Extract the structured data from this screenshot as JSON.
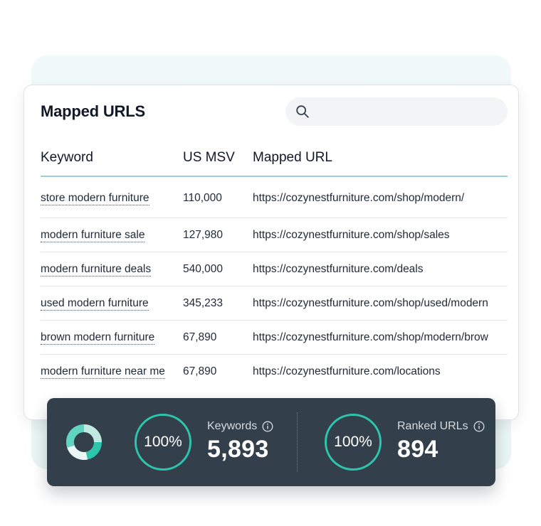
{
  "panel": {
    "title": "Mapped URLS",
    "search": {
      "placeholder": "",
      "value": ""
    }
  },
  "table": {
    "headers": [
      "Keyword",
      "US MSV",
      "Mapped URL"
    ],
    "rows": [
      {
        "keyword": "store modern furniture",
        "msv": "110,000",
        "url": "https://cozynestfurniture.com/shop/modern/"
      },
      {
        "keyword": "modern furniture sale",
        "msv": "127,980",
        "url": "https://cozynestfurniture.com/shop/sales"
      },
      {
        "keyword": "modern furniture deals",
        "msv": "540,000",
        "url": "https://cozynestfurniture.com/deals"
      },
      {
        "keyword": "used modern furniture",
        "msv": "345,233",
        "url": "https://cozynestfurniture.com/shop/used/modern"
      },
      {
        "keyword": "brown modern furniture",
        "msv": "67,890",
        "url": "https://cozynestfurniture.com/shop/modern/brow"
      },
      {
        "keyword": "modern furniture near me",
        "msv": "67,890",
        "url": "https://cozynestfurniture.com/locations"
      }
    ]
  },
  "stats": {
    "logo_icon": "donut-chart-icon",
    "keywords": {
      "percent": "100%",
      "label": "Keywords",
      "value": "5,893",
      "icon": "info-icon"
    },
    "ranked_urls": {
      "percent": "100%",
      "label": "Ranked URLs",
      "value": "894",
      "icon": "info-icon"
    }
  },
  "colors": {
    "accent": "#2ec4ad",
    "stats_background": "#333f4b",
    "header_rule": "#9ccbe0"
  }
}
